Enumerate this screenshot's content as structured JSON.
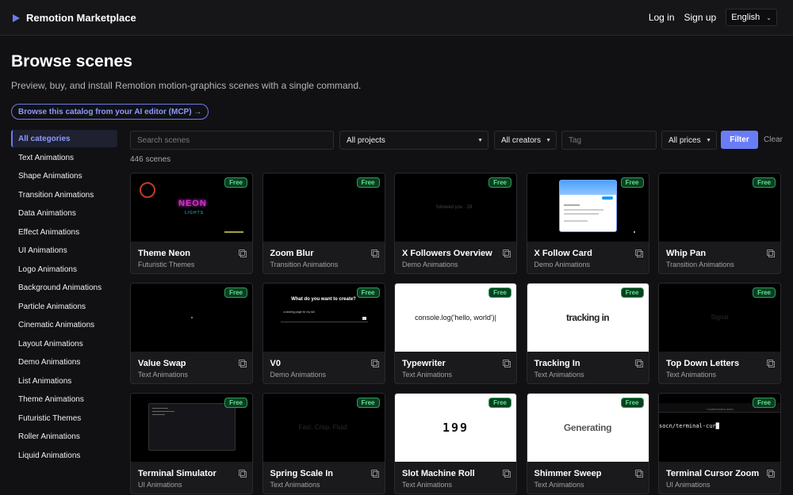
{
  "header": {
    "brand": "Remotion Marketplace",
    "login": "Log in",
    "signup": "Sign up",
    "language": "English"
  },
  "page": {
    "title": "Browse scenes",
    "subtitle": "Preview, buy, and install Remotion motion-graphics scenes with a single command.",
    "mcp_link": "Browse this catalog from your AI editor (MCP) →",
    "scene_count": "446 scenes"
  },
  "sidebar": {
    "items": [
      "All categories",
      "Text Animations",
      "Shape Animations",
      "Transition Animations",
      "Data Animations",
      "Effect Animations",
      "UI Animations",
      "Logo Animations",
      "Background Animations",
      "Particle Animations",
      "Cinematic Animations",
      "Layout Animations",
      "Demo Animations",
      "List Animations",
      "Theme Animations",
      "Futuristic Themes",
      "Roller Animations",
      "Liquid Animations"
    ]
  },
  "filters": {
    "search_placeholder": "Search scenes",
    "projects": "All projects",
    "creators": "All creators",
    "tag_placeholder": "Tag",
    "prices": "All prices",
    "filter_button": "Filter",
    "clear_button": "Clear"
  },
  "badge_label": "Free",
  "cards": [
    {
      "title": "Theme Neon",
      "category": "Futuristic Themes",
      "thumb_text": "NEON",
      "thumb_sub": "LIGHTS"
    },
    {
      "title": "Zoom Blur",
      "category": "Transition Animations"
    },
    {
      "title": "X Followers Overview",
      "category": "Demo Animations",
      "thumb_text": "followed you · 29"
    },
    {
      "title": "X Follow Card",
      "category": "Demo Animations"
    },
    {
      "title": "Whip Pan",
      "category": "Transition Animations"
    },
    {
      "title": "Value Swap",
      "category": "Text Animations"
    },
    {
      "title": "V0",
      "category": "Demo Animations",
      "thumb_text": "What do you want to create?",
      "thumb_sub": "a landing page for my fail"
    },
    {
      "title": "Typewriter",
      "category": "Text Animations",
      "thumb_text": "console.log('hello, world')|"
    },
    {
      "title": "Tracking In",
      "category": "Text Animations",
      "thumb_text": "tracking in"
    },
    {
      "title": "Top Down Letters",
      "category": "Text Animations",
      "thumb_text": "Signal"
    },
    {
      "title": "Terminal Simulator",
      "category": "UI Animations"
    },
    {
      "title": "Spring Scale In",
      "category": "Text Animations",
      "thumb_text": "Fast. Crisp. Fluid."
    },
    {
      "title": "Slot Machine Roll",
      "category": "Text Animations",
      "thumb_text": "199"
    },
    {
      "title": "Shimmer Sweep",
      "category": "Text Animations",
      "thumb_text": "Generating"
    },
    {
      "title": "Terminal Cursor Zoom",
      "category": "UI Animations",
      "thumb_text": "socn/terminal-cur█",
      "thumb_sub": "~/code/remotion-demo"
    }
  ]
}
